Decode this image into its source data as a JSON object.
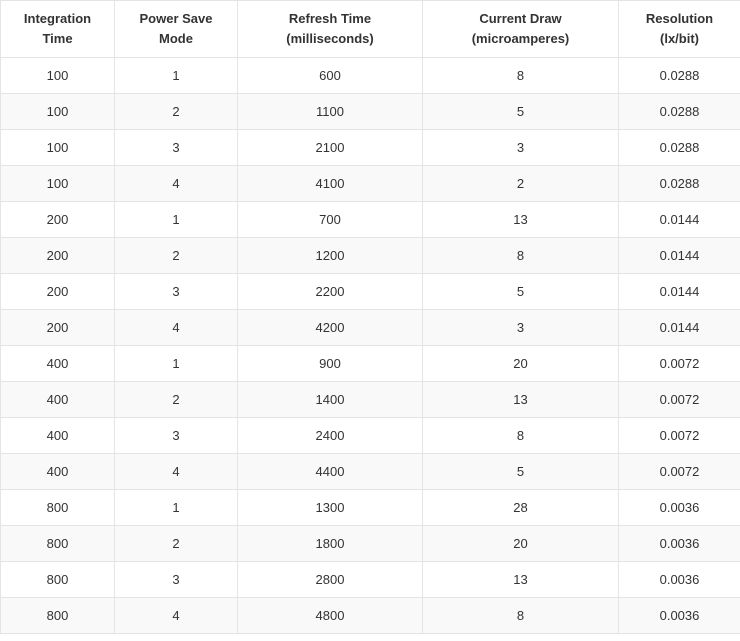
{
  "table": {
    "headers": [
      "Integration\nTime",
      "Power Save\nMode",
      "Refresh Time\n(milliseconds)",
      "Current Draw\n(microamperes)",
      "Resolution\n(lx/bit)"
    ],
    "rows": [
      [
        "100",
        "1",
        "600",
        "8",
        "0.0288"
      ],
      [
        "100",
        "2",
        "1100",
        "5",
        "0.0288"
      ],
      [
        "100",
        "3",
        "2100",
        "3",
        "0.0288"
      ],
      [
        "100",
        "4",
        "4100",
        "2",
        "0.0288"
      ],
      [
        "200",
        "1",
        "700",
        "13",
        "0.0144"
      ],
      [
        "200",
        "2",
        "1200",
        "8",
        "0.0144"
      ],
      [
        "200",
        "3",
        "2200",
        "5",
        "0.0144"
      ],
      [
        "200",
        "4",
        "4200",
        "3",
        "0.0144"
      ],
      [
        "400",
        "1",
        "900",
        "20",
        "0.0072"
      ],
      [
        "400",
        "2",
        "1400",
        "13",
        "0.0072"
      ],
      [
        "400",
        "3",
        "2400",
        "8",
        "0.0072"
      ],
      [
        "400",
        "4",
        "4400",
        "5",
        "0.0072"
      ],
      [
        "800",
        "1",
        "1300",
        "28",
        "0.0036"
      ],
      [
        "800",
        "2",
        "1800",
        "20",
        "0.0036"
      ],
      [
        "800",
        "3",
        "2800",
        "13",
        "0.0036"
      ],
      [
        "800",
        "4",
        "4800",
        "8",
        "0.0036"
      ]
    ]
  }
}
